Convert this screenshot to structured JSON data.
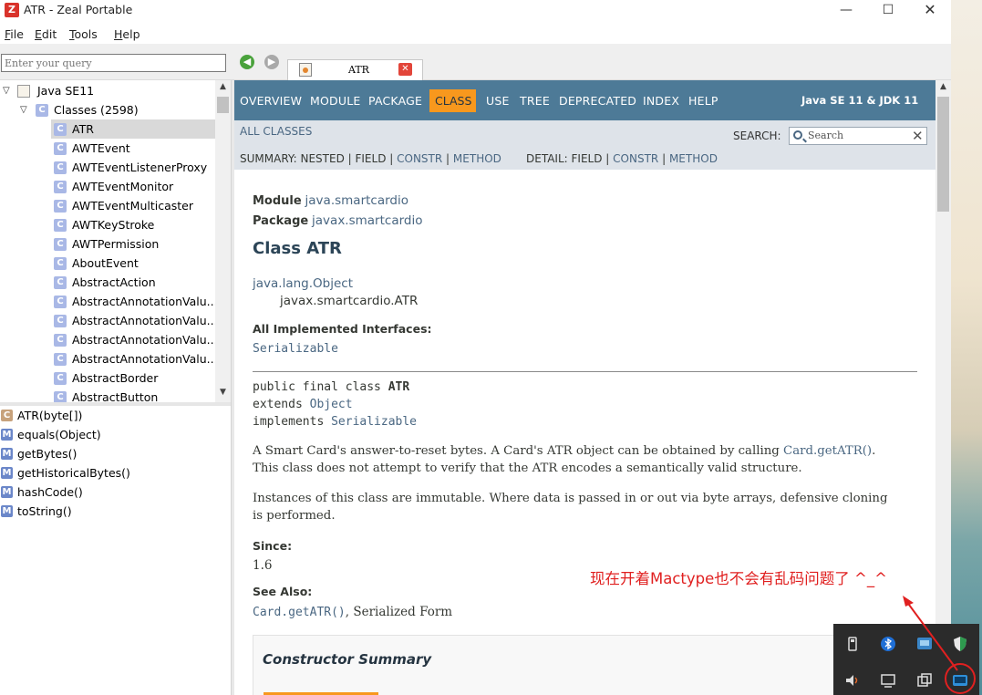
{
  "window": {
    "title": "ATR - Zeal Portable",
    "controls": {
      "minimize": "—",
      "maximize": "☐",
      "close": "✕"
    }
  },
  "menu": [
    {
      "label": "File",
      "mnemonic": "F",
      "rest": "ile"
    },
    {
      "label": "Edit",
      "mnemonic": "E",
      "rest": "dit"
    },
    {
      "label": "Tools",
      "mnemonic": "T",
      "rest": "ools"
    },
    {
      "label": "Help",
      "mnemonic": "H",
      "rest": "elp"
    }
  ],
  "search": {
    "placeholder": "Enter your query"
  },
  "tab": {
    "label": "ATR",
    "close": "✕"
  },
  "tree": {
    "root": "Java SE11",
    "classes_node": "Classes (2598)",
    "items": [
      "ATR",
      "AWTEvent",
      "AWTEventListenerProxy",
      "AWTEventMonitor",
      "AWTEventMulticaster",
      "AWTKeyStroke",
      "AWTPermission",
      "AboutEvent",
      "AbstractAction",
      "AbstractAnnotationValu...",
      "AbstractAnnotationValu...",
      "AbstractAnnotationValu...",
      "AbstractAnnotationValu...",
      "AbstractBorder",
      "AbstractButton"
    ],
    "selected": "ATR"
  },
  "members": [
    {
      "kind": "C",
      "label": "ATR(byte[])",
      "color": "#c7a27c"
    },
    {
      "kind": "M",
      "label": "equals(Object)",
      "color": "#6b87c9"
    },
    {
      "kind": "M",
      "label": "getBytes()",
      "color": "#6b87c9"
    },
    {
      "kind": "M",
      "label": "getHistoricalBytes()",
      "color": "#6b87c9"
    },
    {
      "kind": "M",
      "label": "hashCode()",
      "color": "#6b87c9"
    },
    {
      "kind": "M",
      "label": "toString()",
      "color": "#6b87c9"
    }
  ],
  "doc": {
    "topnav": [
      "OVERVIEW",
      "MODULE",
      "PACKAGE",
      "CLASS",
      "USE",
      "TREE",
      "DEPRECATED",
      "INDEX",
      "HELP"
    ],
    "active_nav": "CLASS",
    "jdk_label": "Java SE 11 & JDK 11",
    "all_classes": "ALL CLASSES",
    "search_label": "SEARCH:",
    "search_placeholder": "Search",
    "summary": {
      "prefix": "SUMMARY: NESTED | FIELD |",
      "constr": "CONSTR",
      "sep": "|",
      "method": "METHOD"
    },
    "detail": {
      "prefix": "DETAIL: FIELD |",
      "constr": "CONSTR",
      "sep": "|",
      "method": "METHOD"
    },
    "module_label": "Module",
    "module_value": "java.smartcardio",
    "package_label": "Package",
    "package_value": "javax.smartcardio",
    "class_title": "Class ATR",
    "hierarchy": [
      "java.lang.Object",
      "javax.smartcardio.ATR"
    ],
    "implemented_label": "All Implemented Interfaces:",
    "implemented_value": "Serializable",
    "signature": {
      "line1_prefix": "public final class ",
      "line1_name": "ATR",
      "line2_prefix": "extends ",
      "line2_link": "Object",
      "line3_prefix": "implements ",
      "line3_link": "Serializable"
    },
    "desc1_a": "A Smart Card's answer-to-reset bytes. A Card's ATR object can be obtained by calling ",
    "desc1_link": "Card.getATR()",
    "desc1_end": ".",
    "desc1_b": "This class does not attempt to verify that the ATR encodes a semantically valid structure.",
    "desc2_a": "Instances of this class are immutable. Where data is passed in or out via byte arrays, defensive cloning",
    "desc2_b": "is performed.",
    "since_label": "Since:",
    "since_value": "1.6",
    "see_also_label": "See Also:",
    "see_also_link1": "Card.getATR()",
    "see_also_sep": ", ",
    "see_also_link2": "Serialized Form",
    "constructor_summary": "Constructor Summary"
  },
  "annotation": {
    "text": "现在开着Mactype也不会有乱码问题了 ^_^",
    "color": "#e02020"
  },
  "colors": {
    "nav_bg": "#4d7a97",
    "nav_active": "#f8981d",
    "subnav_bg": "#dee3e9",
    "link": "#4a6782"
  }
}
